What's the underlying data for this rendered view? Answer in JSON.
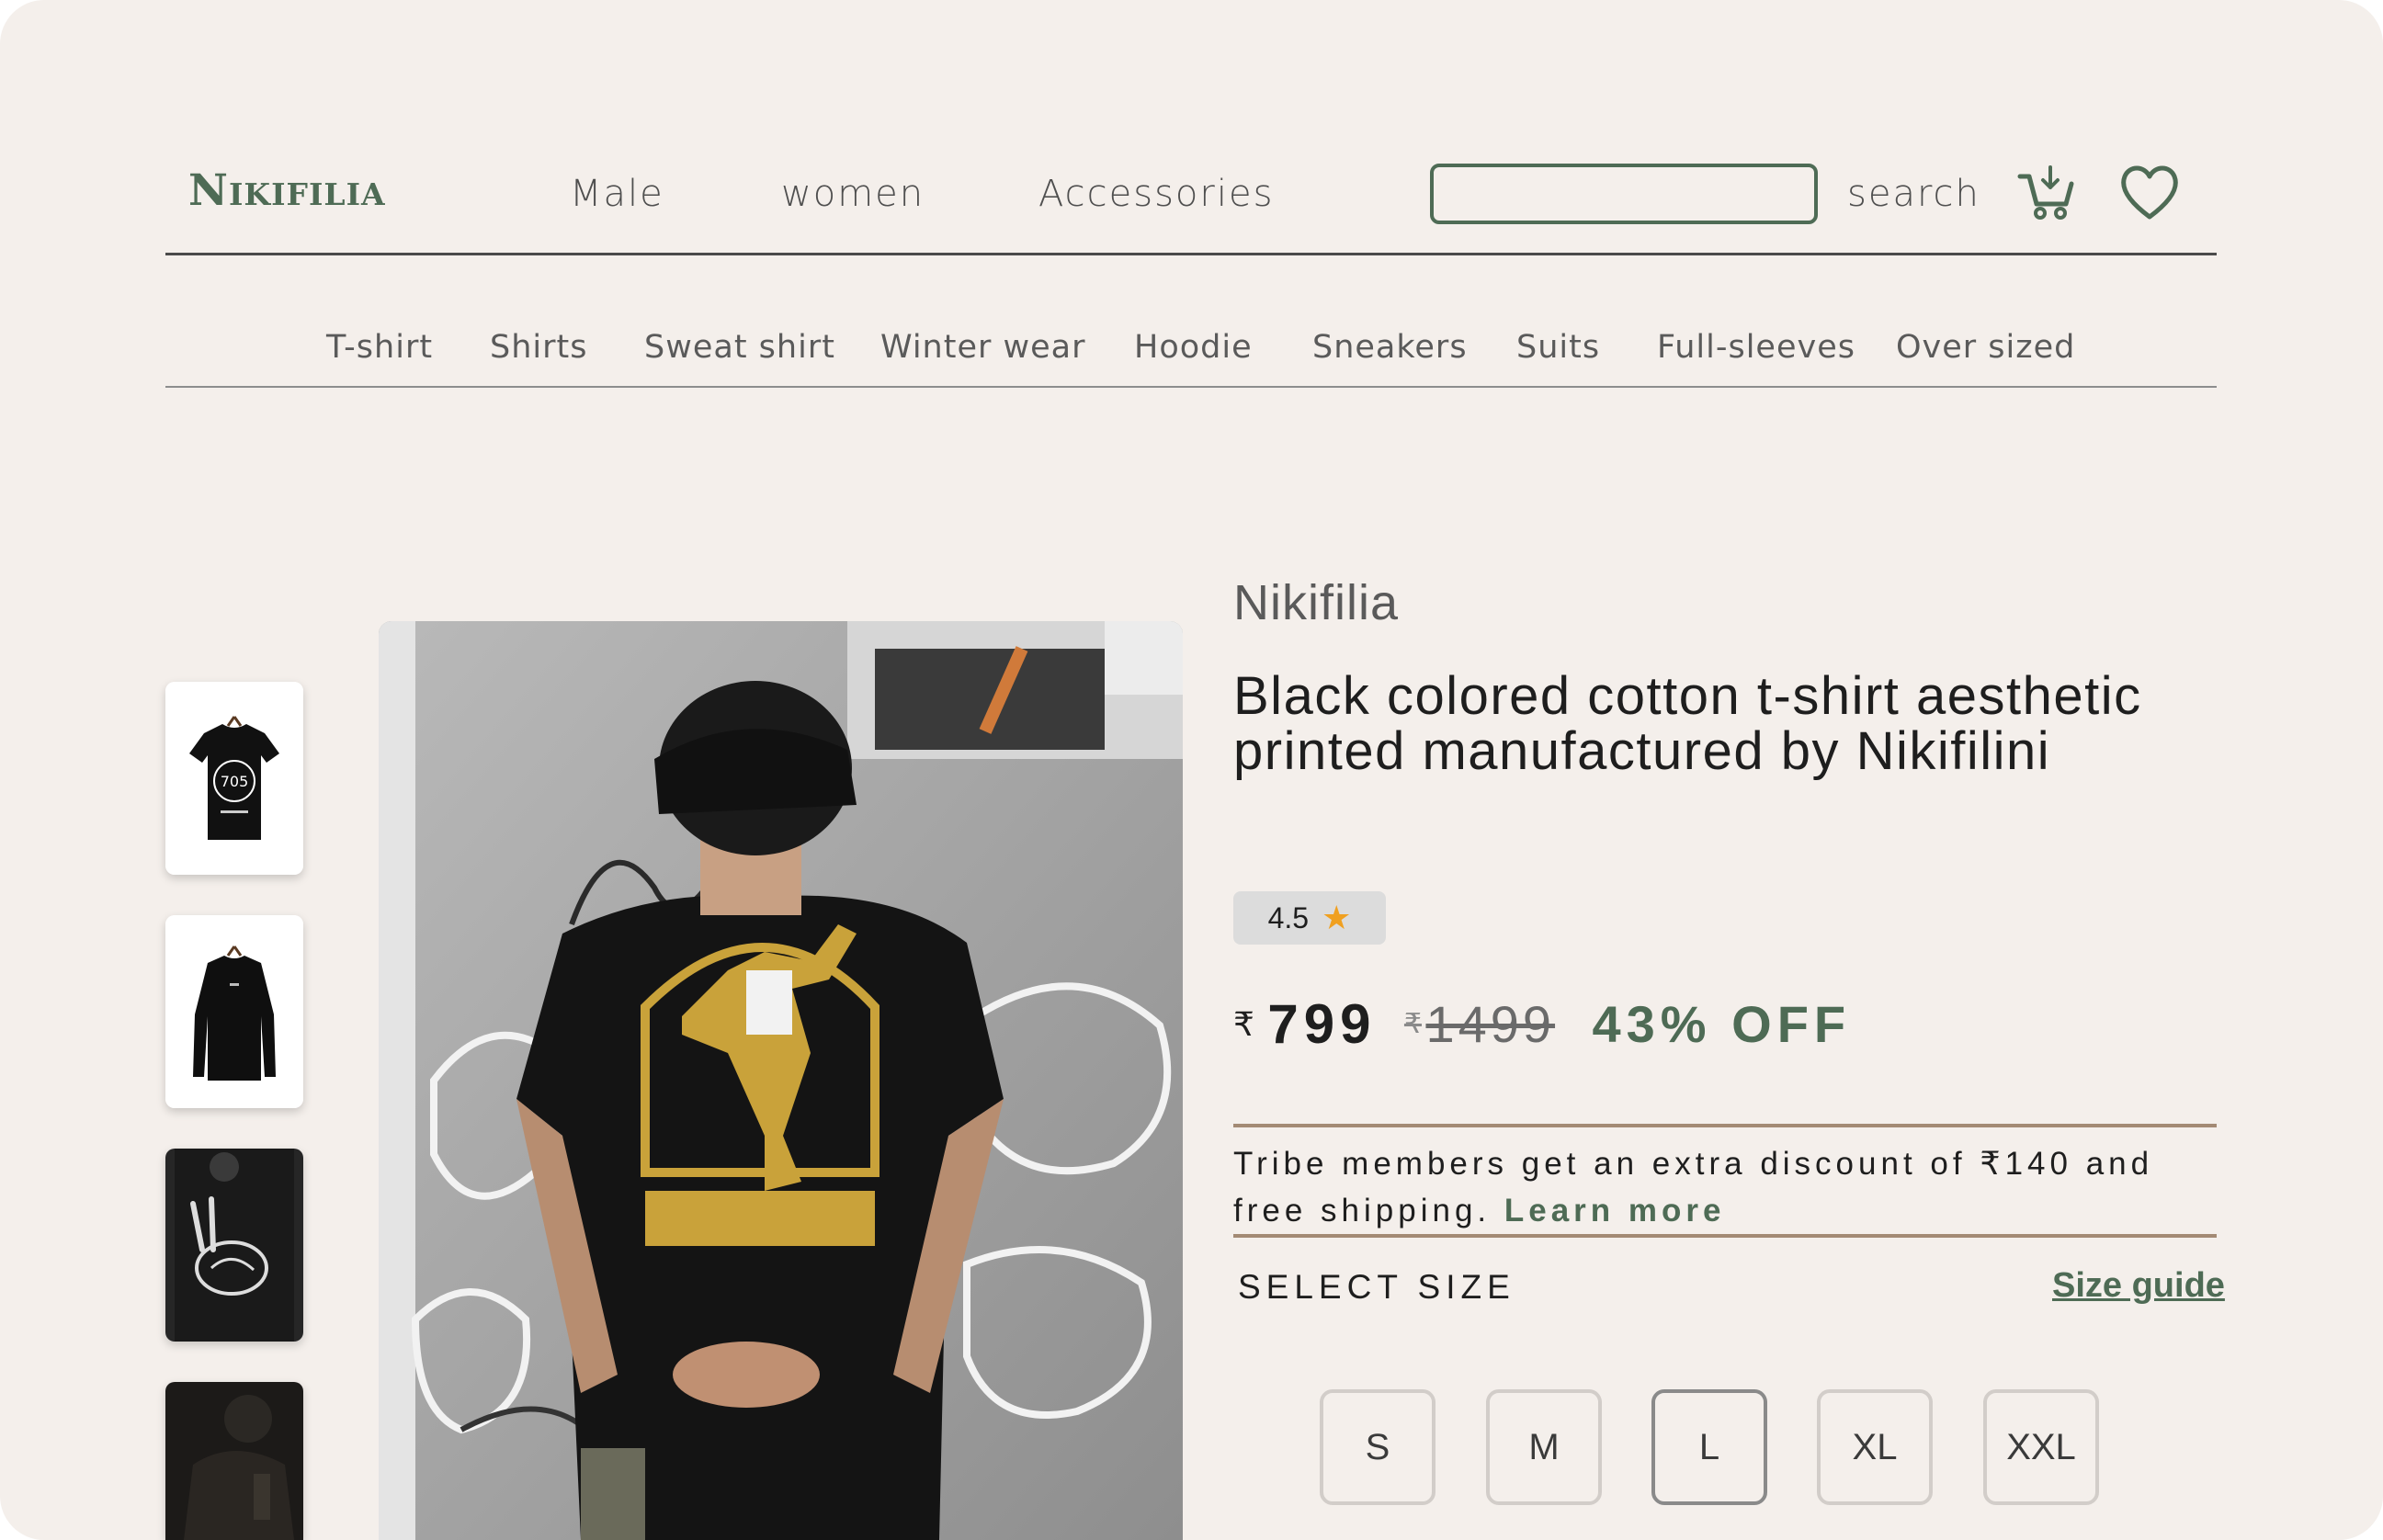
{
  "header": {
    "logo": "Nikifilia",
    "nav": [
      "Male",
      "women",
      "Accessories"
    ],
    "search_placeholder": "",
    "search_label": "search",
    "cart_icon": "cart-icon",
    "wishlist_icon": "heart-icon"
  },
  "categories": [
    "T-shirt",
    "Shirts",
    "Sweat shirt",
    "Winter wear",
    "Hoodie",
    "Sneakers",
    "Suits",
    "Full-sleeves",
    "Over sized"
  ],
  "gallery": {
    "thumb1_print": "705"
  },
  "product": {
    "brand": "Nikifilia",
    "title": "Black colored cotton t-shirt aesthetic printed manufactured by Nikifilini",
    "rating": "4.5",
    "rating_icon": "★",
    "currency_symbol": "₹",
    "price": "799",
    "original_price": "1499",
    "discount": "43% OFF",
    "tribe_text": "Tribe members get an extra discount of ₹140 and free shipping.",
    "learn_more": "Learn more",
    "select_size_label": "SELECT SIZE",
    "size_guide_label": "Size guide",
    "sizes": [
      "S",
      "M",
      "L",
      "XL",
      "XXL"
    ],
    "selected_size": "L"
  },
  "colors": {
    "background": "#f4efeb",
    "brand_green": "#4e6b55",
    "divider_tan": "#a38a74",
    "star": "#f0a020"
  }
}
